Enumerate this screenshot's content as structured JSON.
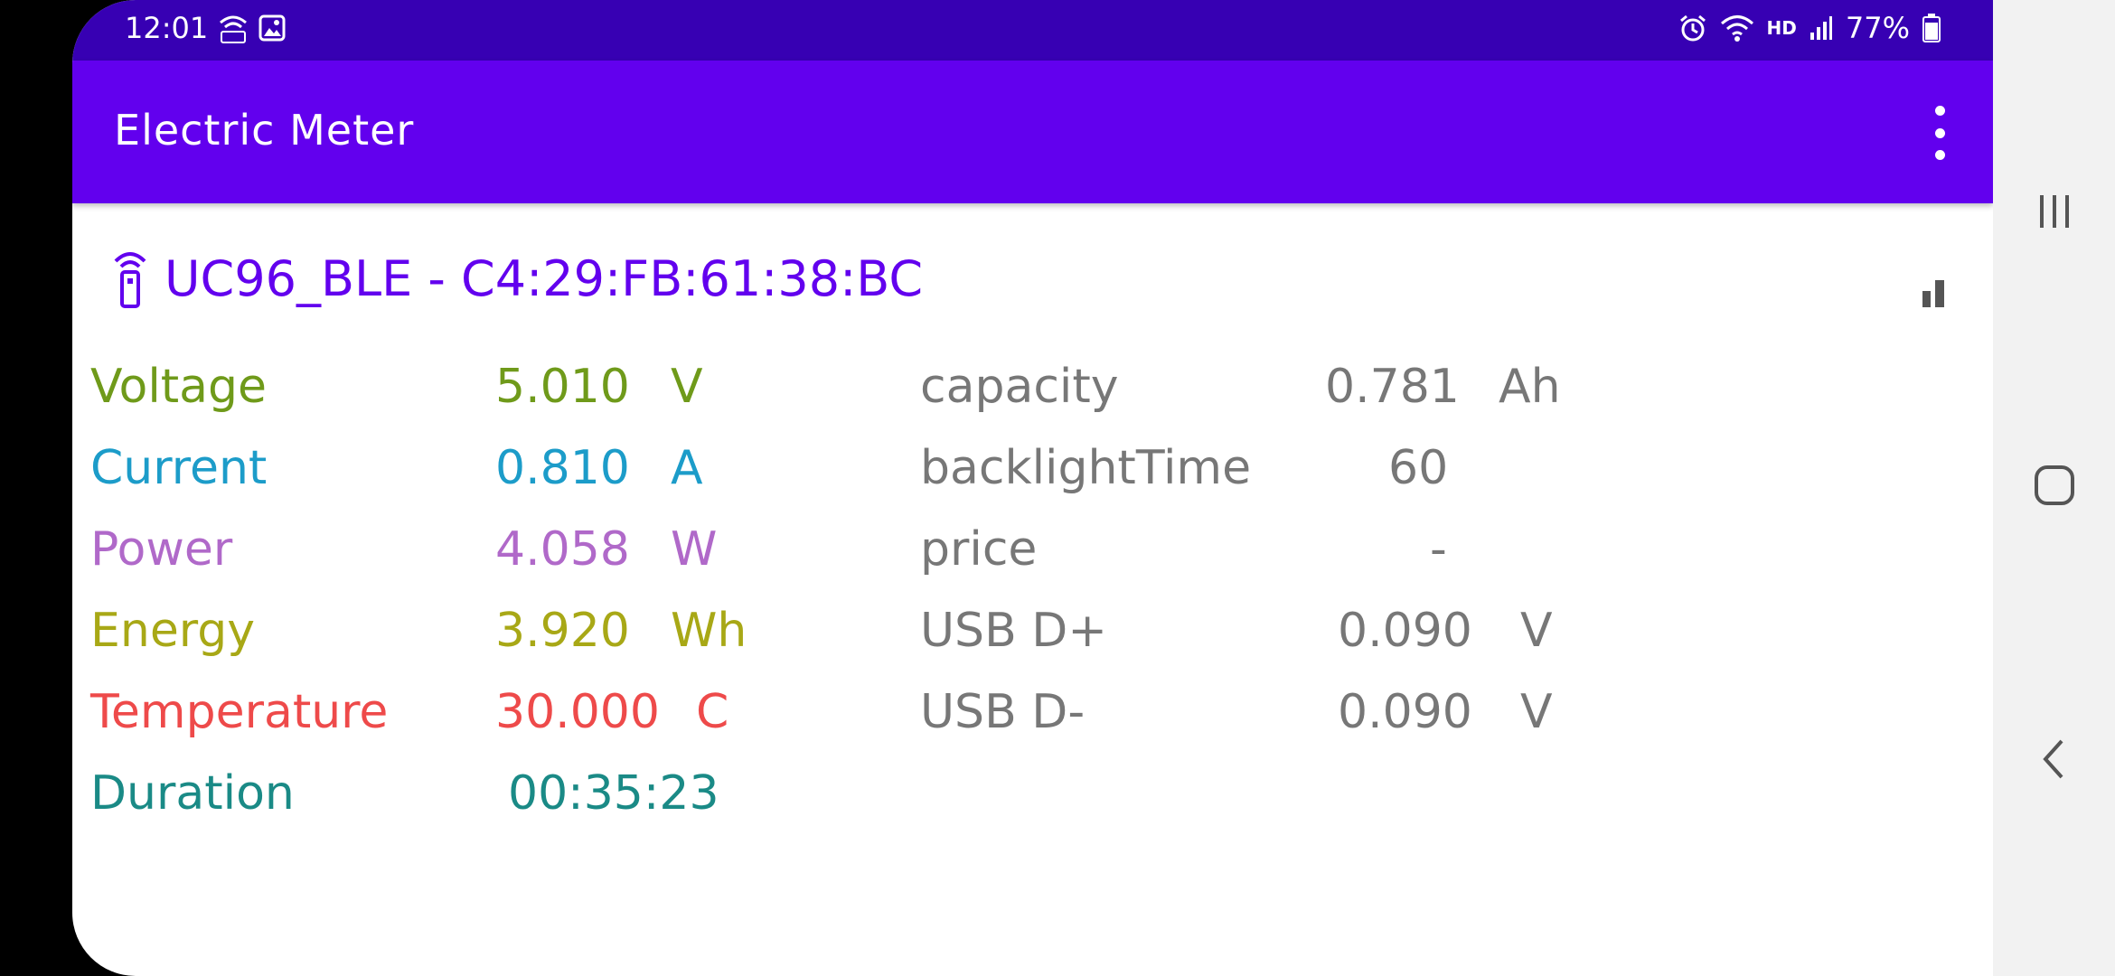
{
  "status_bar": {
    "time": "12:01",
    "battery_percent": "77%",
    "hd_label": "HD"
  },
  "app_bar": {
    "title": "Electric Meter"
  },
  "device": {
    "label": "UC96_BLE - C4:29:FB:61:38:BC"
  },
  "readings_left": [
    {
      "label": "Voltage",
      "value": "5.010",
      "unit": "V",
      "color": "#6f9a1a"
    },
    {
      "label": "Current",
      "value": "0.810",
      "unit": "A",
      "color": "#1c9cc9"
    },
    {
      "label": "Power",
      "value": "4.058",
      "unit": "W",
      "color": "#b069c9"
    },
    {
      "label": "Energy",
      "value": "3.920",
      "unit": "Wh",
      "color": "#a8a816"
    },
    {
      "label": "Temperature",
      "value": "30.000",
      "unit": "C",
      "color": "#ee4a4a"
    },
    {
      "label": "Duration",
      "value": "00:35:23",
      "unit": "",
      "color": "#1a8a86"
    }
  ],
  "readings_right": [
    {
      "label": "capacity",
      "value": "0.781",
      "unit": "Ah"
    },
    {
      "label": "backlightTime",
      "value": "60",
      "unit": ""
    },
    {
      "label": "price",
      "value": "-",
      "unit": ""
    },
    {
      "label": "USB D+",
      "value": "0.090",
      "unit": "V"
    },
    {
      "label": "USB D-",
      "value": "0.090",
      "unit": "V"
    }
  ],
  "colors": {
    "status_bar": "#3700b3",
    "app_bar": "#6200ee",
    "right_text": "#777777"
  }
}
